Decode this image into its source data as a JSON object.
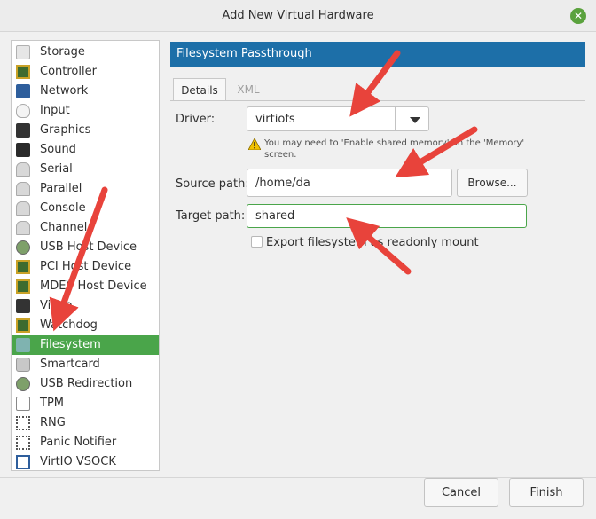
{
  "window": {
    "title": "Add New Virtual Hardware"
  },
  "sidebar": {
    "items": [
      {
        "label": "Storage",
        "icon": "storage-icon"
      },
      {
        "label": "Controller",
        "icon": "controller-icon"
      },
      {
        "label": "Network",
        "icon": "network-icon"
      },
      {
        "label": "Input",
        "icon": "mouse-icon"
      },
      {
        "label": "Graphics",
        "icon": "monitor-icon"
      },
      {
        "label": "Sound",
        "icon": "sound-icon"
      },
      {
        "label": "Serial",
        "icon": "serial-icon"
      },
      {
        "label": "Parallel",
        "icon": "parallel-icon"
      },
      {
        "label": "Console",
        "icon": "console-icon"
      },
      {
        "label": "Channel",
        "icon": "channel-icon"
      },
      {
        "label": "USB Host Device",
        "icon": "usb-icon"
      },
      {
        "label": "PCI Host Device",
        "icon": "pci-icon"
      },
      {
        "label": "MDEV Host Device",
        "icon": "mdev-icon"
      },
      {
        "label": "Video",
        "icon": "video-icon"
      },
      {
        "label": "Watchdog",
        "icon": "watchdog-icon"
      },
      {
        "label": "Filesystem",
        "icon": "folder-icon"
      },
      {
        "label": "Smartcard",
        "icon": "smartcard-icon"
      },
      {
        "label": "USB Redirection",
        "icon": "usb-redirection-icon"
      },
      {
        "label": "TPM",
        "icon": "tpm-icon"
      },
      {
        "label": "RNG",
        "icon": "rng-icon"
      },
      {
        "label": "Panic Notifier",
        "icon": "panic-notifier-icon"
      },
      {
        "label": "VirtIO VSOCK",
        "icon": "vsock-icon"
      }
    ],
    "selected": "Filesystem"
  },
  "main": {
    "banner": "Filesystem Passthrough",
    "tabs": [
      "Details",
      "XML"
    ],
    "active_tab": "Details",
    "driver_label": "Driver:",
    "driver_value": "virtiofs",
    "warning": "You may need to 'Enable shared memory' on the 'Memory' screen.",
    "source_label": "Source path:",
    "source_value": "/home/da",
    "browse_label": "Browse...",
    "target_label": "Target path:",
    "target_value": "shared",
    "readonly_label": "Export filesystem as readonly mount",
    "readonly_checked": false
  },
  "footer": {
    "cancel_label": "Cancel",
    "finish_label": "Finish"
  },
  "colors": {
    "accent": "#4aa54a",
    "banner": "#1d6fa8",
    "annotation_arrow": "#e8433b"
  }
}
